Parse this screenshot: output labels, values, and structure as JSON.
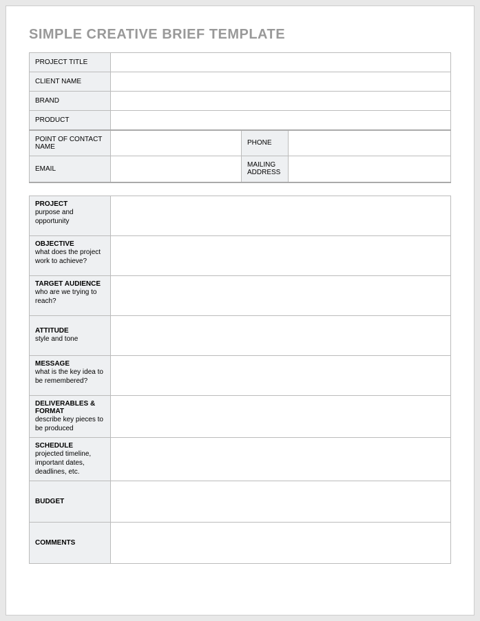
{
  "title": "SIMPLE CREATIVE BRIEF TEMPLATE",
  "basic": {
    "project_title": {
      "label": "PROJECT TITLE",
      "value": ""
    },
    "client_name": {
      "label": "CLIENT NAME",
      "value": ""
    },
    "brand": {
      "label": "BRAND",
      "value": ""
    },
    "product": {
      "label": "PRODUCT",
      "value": ""
    }
  },
  "contact": {
    "poc": {
      "label": "POINT OF CONTACT NAME",
      "value": ""
    },
    "phone": {
      "label": "PHONE",
      "value": ""
    },
    "email": {
      "label": "EMAIL",
      "value": ""
    },
    "mailing": {
      "label": "MAILING ADDRESS",
      "value": ""
    }
  },
  "sections": {
    "project": {
      "title": "PROJECT",
      "desc": "purpose and opportunity",
      "value": ""
    },
    "objective": {
      "title": "OBJECTIVE",
      "desc": "what does the project work to achieve?",
      "value": ""
    },
    "target": {
      "title": "TARGET AUDIENCE",
      "desc": "who are we trying to reach?",
      "value": ""
    },
    "attitude": {
      "title": "ATTITUDE",
      "desc": "style and tone",
      "value": ""
    },
    "message": {
      "title": "MESSAGE",
      "desc": "what is the key idea to be remembered?",
      "value": ""
    },
    "deliverables": {
      "title": "DELIVERABLES & FORMAT",
      "desc": " describe key pieces to be produced",
      "value": ""
    },
    "schedule": {
      "title": "SCHEDULE",
      "desc": "projected timeline, important dates, deadlines, etc.",
      "value": ""
    },
    "budget": {
      "title": "BUDGET",
      "desc": "",
      "value": ""
    },
    "comments": {
      "title": "COMMENTS",
      "desc": "",
      "value": ""
    }
  }
}
